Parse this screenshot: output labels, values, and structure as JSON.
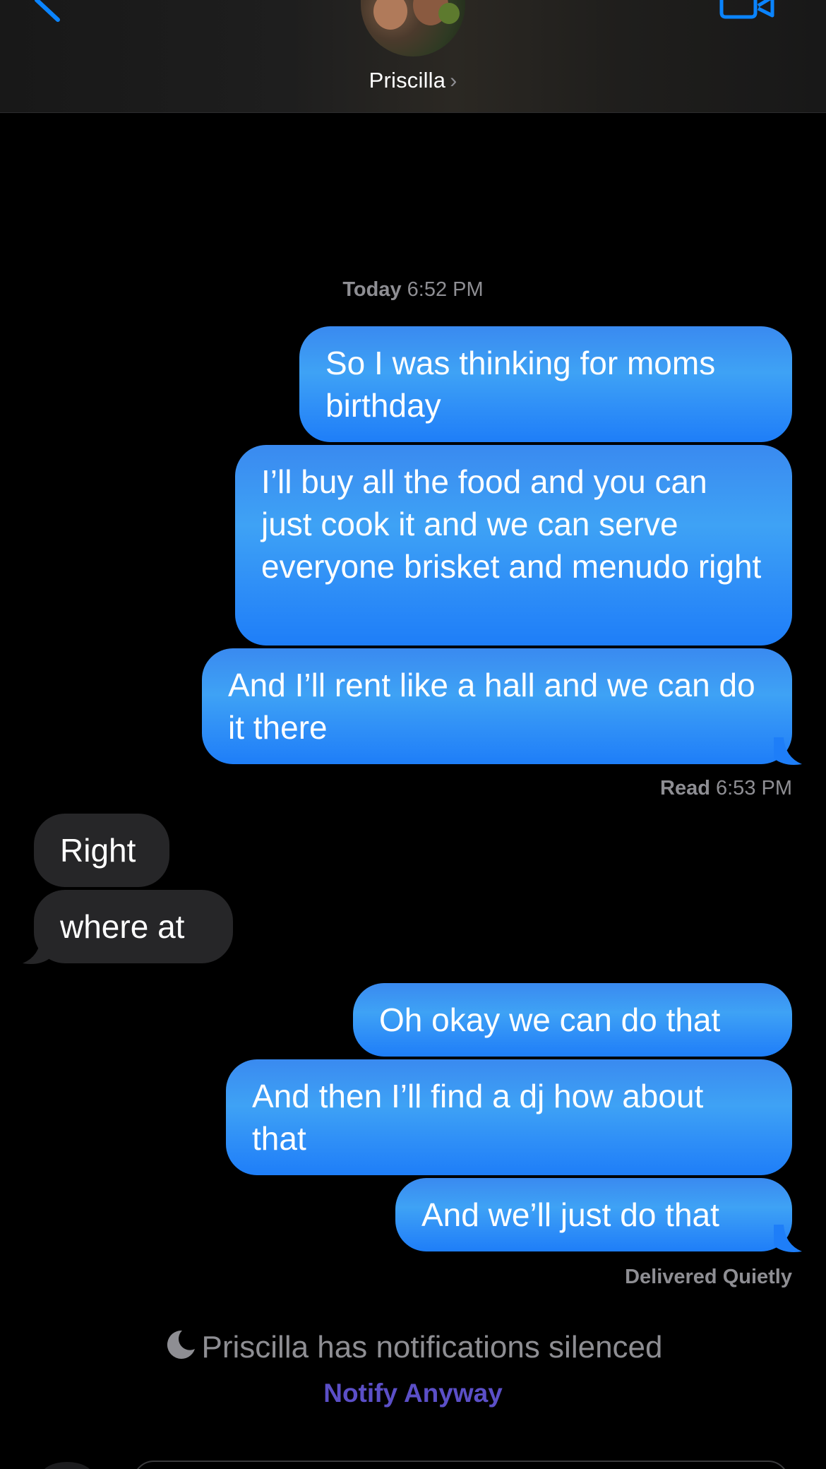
{
  "header": {
    "contact_name": "Priscilla",
    "chevron": "›",
    "back_icon": "chevron-left-icon",
    "video_icon": "video-camera-icon",
    "accent_color": "#0a84ff"
  },
  "conversation": {
    "timestamp_day": "Today",
    "timestamp_time": "6:52 PM",
    "group1": [
      "So I was thinking for moms birthday",
      "I’ll buy all the food and you can just cook it and we can serve everyone brisket and menudo right",
      "And I’ll rent like a hall and we can do it there"
    ],
    "read_label": "Read",
    "read_time": "6:53 PM",
    "incoming": [
      "Right",
      "where at"
    ],
    "group2": [
      "Oh okay we can do that",
      "And then I’ll find a dj how about that",
      "And we’ll just do that"
    ],
    "delivered_label": "Delivered Quietly"
  },
  "focus_notice": {
    "moon_icon": "moon-icon",
    "text": "Priscilla has notifications silenced",
    "action_label": "Notify Anyway",
    "action_color": "#5b4fc7"
  },
  "colors": {
    "outgoing_bubble": "#1e7ef8",
    "incoming_bubble": "#262628",
    "background": "#000000"
  }
}
